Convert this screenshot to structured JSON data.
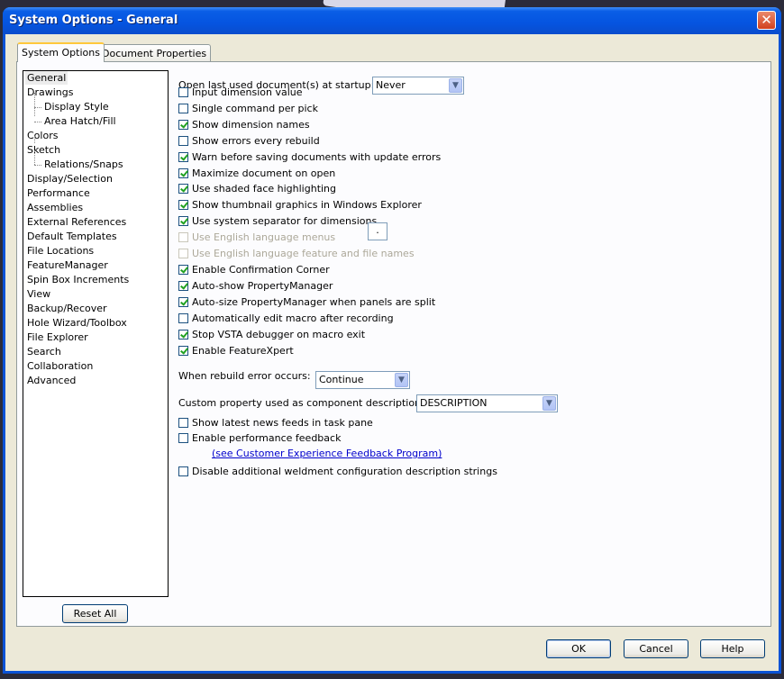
{
  "window": {
    "title": "System Options - General",
    "close_glyph": "✕"
  },
  "tabs": [
    {
      "label": "System Options"
    },
    {
      "label": "Document Properties"
    }
  ],
  "tree": {
    "items": [
      {
        "label": "General"
      },
      {
        "label": "Drawings"
      },
      {
        "label": "Display Style"
      },
      {
        "label": "Area Hatch/Fill"
      },
      {
        "label": "Colors"
      },
      {
        "label": "Sketch"
      },
      {
        "label": "Relations/Snaps"
      },
      {
        "label": "Display/Selection"
      },
      {
        "label": "Performance"
      },
      {
        "label": "Assemblies"
      },
      {
        "label": "External References"
      },
      {
        "label": "Default Templates"
      },
      {
        "label": "File Locations"
      },
      {
        "label": "FeatureManager"
      },
      {
        "label": "Spin Box Increments"
      },
      {
        "label": "View"
      },
      {
        "label": "Backup/Recover"
      },
      {
        "label": "Hole Wizard/Toolbox"
      },
      {
        "label": "File Explorer"
      },
      {
        "label": "Search"
      },
      {
        "label": "Collaboration"
      },
      {
        "label": "Advanced"
      }
    ],
    "reset_label": "Reset All"
  },
  "options": {
    "startup_label": "Open last used document(s) at startup:",
    "startup_value": "Never",
    "checkboxes": [
      {
        "label": "Input dimension value",
        "checked": false,
        "enabled": true
      },
      {
        "label": "Single command per pick",
        "checked": false,
        "enabled": true
      },
      {
        "label": "Show dimension names",
        "checked": true,
        "enabled": true
      },
      {
        "label": "Show errors every rebuild",
        "checked": false,
        "enabled": true
      },
      {
        "label": "Warn before saving documents with update errors",
        "checked": true,
        "enabled": true
      },
      {
        "label": "Maximize document on open",
        "checked": true,
        "enabled": true
      },
      {
        "label": "Use shaded face highlighting",
        "checked": true,
        "enabled": true
      },
      {
        "label": "Show thumbnail graphics in Windows Explorer",
        "checked": true,
        "enabled": true
      },
      {
        "label": "Use system separator for dimensions",
        "checked": true,
        "enabled": true
      },
      {
        "label": "Use English language menus",
        "checked": false,
        "enabled": false
      },
      {
        "label": "Use English language feature and file names",
        "checked": false,
        "enabled": false
      },
      {
        "label": "Enable Confirmation Corner",
        "checked": true,
        "enabled": true
      },
      {
        "label": "Auto-show PropertyManager",
        "checked": true,
        "enabled": true
      },
      {
        "label": "Auto-size PropertyManager when panels are split",
        "checked": true,
        "enabled": true
      },
      {
        "label": "Automatically edit macro after recording",
        "checked": false,
        "enabled": true
      },
      {
        "label": "Stop VSTA debugger on macro exit",
        "checked": true,
        "enabled": true
      },
      {
        "label": "Enable FeatureXpert",
        "checked": true,
        "enabled": true
      }
    ],
    "separator_value": ".",
    "rebuild_label": "When rebuild error occurs:",
    "rebuild_value": "Continue",
    "custom_prop_label": "Custom property used as component description:",
    "custom_prop_value": "DESCRIPTION",
    "news_label": "Show latest news feeds in task pane",
    "news_checked": false,
    "feedback_label": "Enable performance feedback",
    "feedback_checked": false,
    "feedback_link": "(see Customer Experience Feedback Program)",
    "weldment_label": "Disable additional weldment configuration description strings",
    "weldment_checked": false
  },
  "buttons": {
    "ok": "OK",
    "cancel": "Cancel",
    "help": "Help"
  }
}
